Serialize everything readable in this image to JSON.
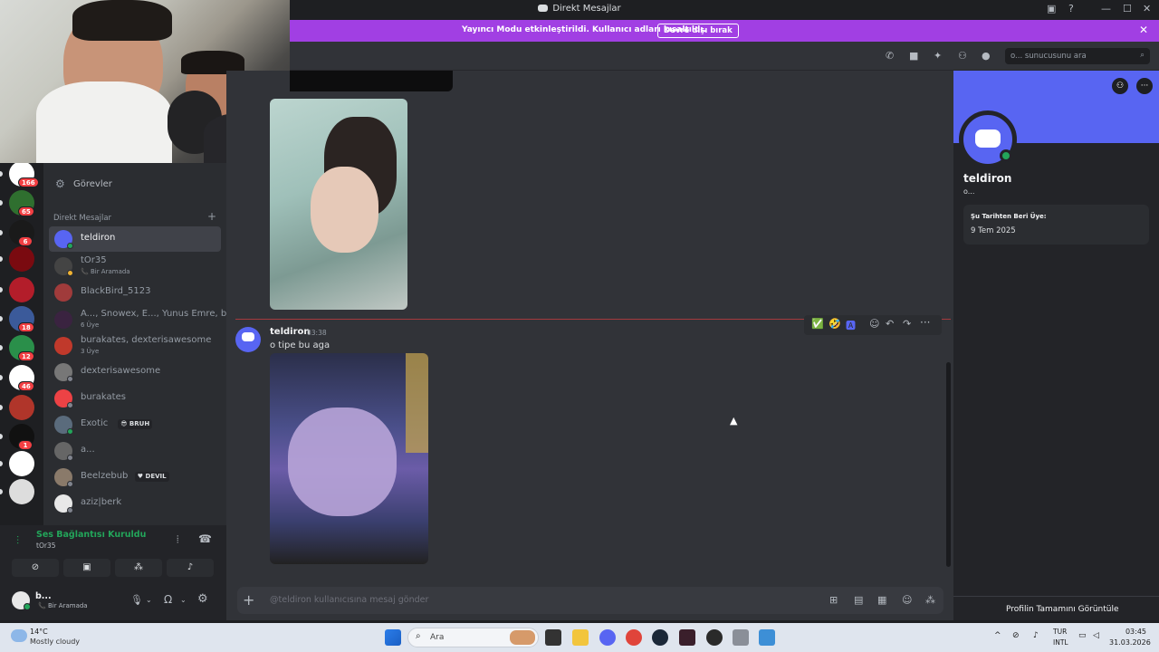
{
  "window": {
    "title": "Direkt Mesajlar",
    "controls": [
      "—",
      "☐",
      "✕"
    ]
  },
  "banner": {
    "message": "Yayıncı Modu etkinleştirildi. Kullanıcı adları kısaltıldı.",
    "button": "Devre dışı bırak"
  },
  "header": {
    "search_placeholder": "o... sunucusunu ara"
  },
  "guilds": {
    "badges": [
      "166",
      "65",
      "6",
      "18",
      "12",
      "46",
      "1"
    ],
    "colors": [
      "#ffffff",
      "#2f6f2f",
      "#1a1a1a",
      "#7a0a10",
      "#b31d2a",
      "#3b5a9a",
      "#2a8f4a",
      "#ffffff",
      "#b0352a",
      "#111111",
      "#ffffff",
      "#dddddd"
    ]
  },
  "sidebar": {
    "quests_label": "Görevler",
    "dm_header": "Direkt Mesajlar",
    "dm_add": "+",
    "dms": [
      {
        "name": "teldiron",
        "sub": "",
        "tag": "",
        "avatar": "#5865f2",
        "status": "#23a55a",
        "active": true
      },
      {
        "name": "tOr35",
        "sub": "📞 Bir Aramada",
        "tag": "",
        "avatar": "#444444",
        "status": "#f0b232",
        "active": false
      },
      {
        "name": "BlackBird_5123",
        "sub": "",
        "tag": "",
        "avatar": "#a03b3b",
        "status": "",
        "active": false
      },
      {
        "name": "A..., Snowex, E..., Yunus Emre, b...",
        "sub": "6 Üye",
        "tag": "",
        "avatar": "#3a2340",
        "status": "",
        "active": false
      },
      {
        "name": "burakates, dexterisawesome",
        "sub": "3 Üye",
        "tag": "",
        "avatar": "#c0392b",
        "status": "",
        "active": false
      },
      {
        "name": "dexterisawesome",
        "sub": "",
        "tag": "",
        "avatar": "#777777",
        "status": "#80848e",
        "active": false
      },
      {
        "name": "burakates",
        "sub": "",
        "tag": "",
        "avatar": "#ed4245",
        "status": "#80848e",
        "active": false
      },
      {
        "name": "Exotic",
        "sub": "",
        "tag": "😎 BRUH",
        "avatar": "#5a6b7c",
        "status": "#23a55a",
        "active": false
      },
      {
        "name": "a...",
        "sub": "",
        "tag": "",
        "avatar": "#666666",
        "status": "#80848e",
        "active": false
      },
      {
        "name": "Beelzebub",
        "sub": "",
        "tag": "♥ DEVIL",
        "avatar": "#8a7a6a",
        "status": "#80848e",
        "active": false
      },
      {
        "name": "aziz|berk",
        "sub": "",
        "tag": "",
        "avatar": "#e8e8e8",
        "status": "#80848e",
        "active": false
      }
    ]
  },
  "voice": {
    "status": "Ses Bağlantısı Kuruldu",
    "channel": "tOr35",
    "user_name": "b...",
    "user_status": "Bir Aramada"
  },
  "chat": {
    "message": {
      "author": "teldiron",
      "time": "03:38",
      "text": "o tipe bu aga"
    },
    "composer_placeholder": "@teldiron kullanıcısına mesaj gönder",
    "reactions": [
      "✅",
      "🤣",
      "🅰"
    ]
  },
  "profile": {
    "display_name": "teldiron",
    "username": "o...",
    "member_since_label": "Şu Tarihten Beri Üye:",
    "member_since": "9 Tem 2025",
    "full_profile": "Profilin Tamamını Görüntüle"
  },
  "taskbar": {
    "weather_temp": "14°C",
    "weather_desc": "Mostly cloudy",
    "search": "Ara",
    "lang_top": "TUR",
    "lang_bottom": "INTL",
    "time": "03:45",
    "date": "31.03.2026"
  }
}
